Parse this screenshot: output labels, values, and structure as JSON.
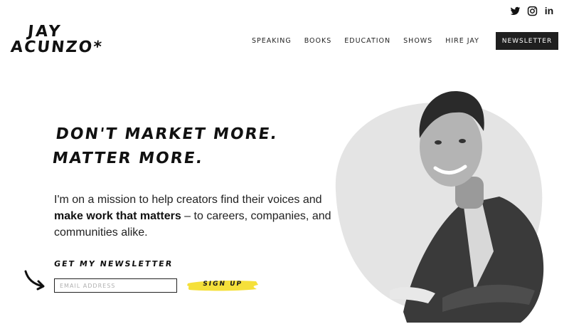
{
  "social": {
    "twitter_icon": "twitter-bird",
    "instagram_icon": "instagram-camera",
    "linkedin_label": "in"
  },
  "logo": {
    "line1": "JAY",
    "line2": "ACUNZO*"
  },
  "nav": {
    "items": [
      "SPEAKING",
      "BOOKS",
      "EDUCATION",
      "SHOWS",
      "HIRE JAY"
    ],
    "newsletter_button": "NEWSLETTER"
  },
  "hero": {
    "title_line1": "DON'T MARKET MORE.",
    "title_line2": "MATTER MORE.",
    "intro_part1": "I'm on a mission to help creators find their voices and",
    "intro_bold": "make work that matters",
    "intro_part2": " – to careers, companies, and communities alike."
  },
  "newsletter": {
    "heading": "GET MY NEWSLETTER",
    "email_placeholder": "EMAIL ADDRESS",
    "email_value": "",
    "signup_label": "SIGN UP"
  },
  "colors": {
    "accent_yellow": "#f5e03a",
    "dark": "#1f1f1f",
    "photo_blob": "#e4e4e4"
  }
}
